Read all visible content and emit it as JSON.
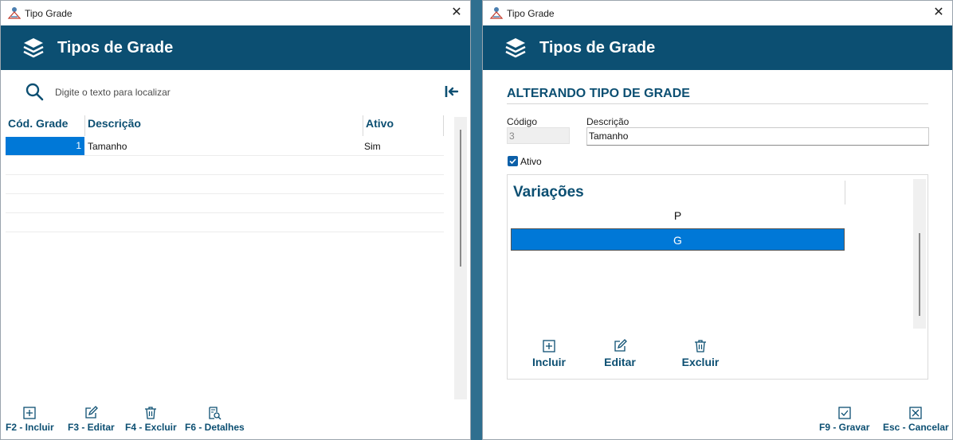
{
  "colors": {
    "header": "#0c4f72",
    "selection": "#0078d7",
    "label": "#0c4f72"
  },
  "left": {
    "window_title": "Tipo Grade",
    "header_title": "Tipos de Grade",
    "search": {
      "placeholder": "Digite o texto para localizar",
      "value": ""
    },
    "columns": [
      "Cód. Grade",
      "Descrição",
      "Ativo"
    ],
    "rows": [
      {
        "code": "1",
        "description": "Tamanho",
        "active": "Sim"
      }
    ],
    "footer": {
      "include": "F2 - Incluir",
      "edit": "F3 - Editar",
      "delete": "F4 - Excluir",
      "details": "F6 - Detalhes"
    }
  },
  "right": {
    "window_title": "Tipo Grade",
    "header_title": "Tipos de Grade",
    "section_title": "ALTERANDO TIPO DE GRADE",
    "code_label": "Código",
    "code_value": "3",
    "desc_label": "Descrição",
    "desc_value": "Tamanho",
    "active_label": "Ativo",
    "active_checked": true,
    "variations_title": "Variações",
    "variations": [
      "P",
      "G"
    ],
    "var_actions": {
      "include": "Incluir",
      "edit": "Editar",
      "delete": "Excluir"
    },
    "footer": {
      "save": "F9 - Gravar",
      "cancel": "Esc - Cancelar"
    }
  }
}
